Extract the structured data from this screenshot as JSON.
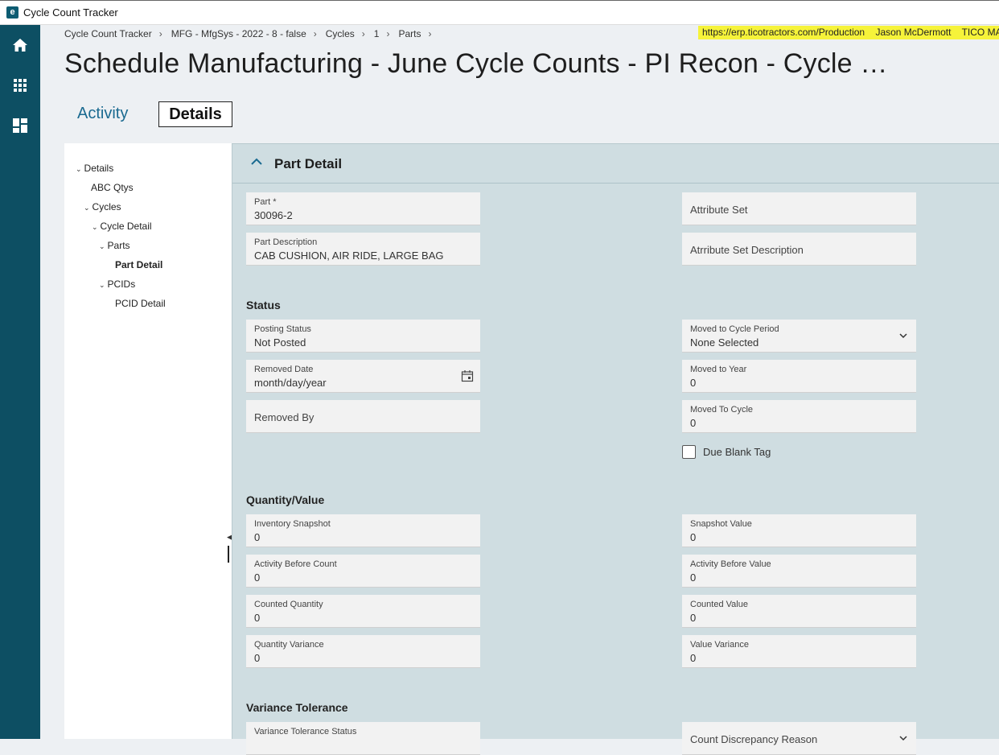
{
  "window": {
    "title": "Cycle Count Tracker",
    "app_icon_glyph": "e"
  },
  "rail": {
    "icons": [
      "home-icon",
      "apps-grid-icon",
      "dashboard-icon"
    ],
    "bg_color": "#0d4f63"
  },
  "breadcrumb": [
    "Cycle Count Tracker",
    "MFG - MfgSys - 2022 - 8 - false",
    "Cycles",
    "1",
    "Parts"
  ],
  "environment": {
    "url": "https://erp.ticotractors.com/Production",
    "user": "Jason McDermott",
    "company": "TICO MANUF",
    "highlight_color": "#f6f33a"
  },
  "page_title": "Schedule Manufacturing - June Cycle Counts - PI Recon - Cycle …",
  "tabs": {
    "activity": "Activity",
    "details": "Details",
    "selected": "Details"
  },
  "tree": {
    "details": "Details",
    "abc_qtys": "ABC Qtys",
    "cycles": "Cycles",
    "cycle_detail": "Cycle Detail",
    "parts": "Parts",
    "part_detail": "Part Detail",
    "pcids": "PCIDs",
    "pcid_detail": "PCID Detail",
    "selected": "Part Detail"
  },
  "section": {
    "title": "Part Detail"
  },
  "part": {
    "part_label": "Part *",
    "part_value": "30096-2",
    "desc_label": "Part Description",
    "desc_value": "CAB CUSHION, AIR RIDE, LARGE BAG",
    "attribute_set_placeholder": "Attribute Set",
    "attribute_set_desc_placeholder": "Atrribute Set Description"
  },
  "status": {
    "heading": "Status",
    "posting_status_label": "Posting Status",
    "posting_status_value": "Not Posted",
    "removed_date_label": "Removed Date",
    "removed_date_value": "month/day/year",
    "removed_by_placeholder": "Removed By",
    "moved_period_label": "Moved to Cycle Period",
    "moved_period_value": "None Selected",
    "moved_year_label": "Moved to Year",
    "moved_year_value": "0",
    "moved_cycle_label": "Moved To Cycle",
    "moved_cycle_value": "0",
    "due_blank_tag_label": "Due Blank Tag",
    "due_blank_tag_checked": false
  },
  "quantity": {
    "heading": "Quantity/Value",
    "inv_snapshot_label": "Inventory Snapshot",
    "inv_snapshot_value": "0",
    "activity_before_count_label": "Activity Before Count",
    "activity_before_count_value": "0",
    "counted_qty_label": "Counted Quantity",
    "counted_qty_value": "0",
    "qty_variance_label": "Quantity Variance",
    "qty_variance_value": "0",
    "snapshot_value_label": "Snapshot Value",
    "snapshot_value_value": "0",
    "activity_before_value_label": "Activity Before Value",
    "activity_before_value_value": "0",
    "counted_value_label": "Counted Value",
    "counted_value_value": "0",
    "value_variance_label": "Value Variance",
    "value_variance_value": "0"
  },
  "variance": {
    "heading": "Variance Tolerance",
    "tolerance_status_label": "Variance Tolerance Status",
    "discrepancy_reason_placeholder": "Count Discrepancy Reason"
  }
}
